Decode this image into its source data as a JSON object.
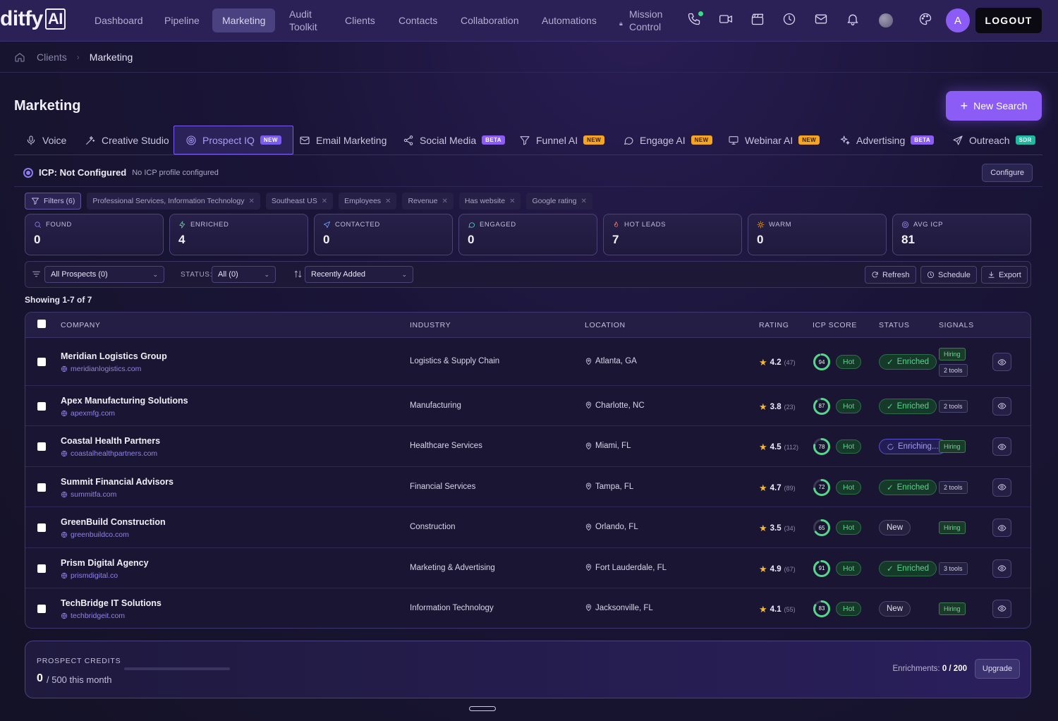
{
  "app": {
    "logo_text": "ditfy",
    "logo_ai": "AI",
    "nav": [
      {
        "label": "Dashboard"
      },
      {
        "label": "Pipeline"
      },
      {
        "label": "Marketing",
        "active": true
      },
      {
        "label_line1": "Audit",
        "label_line2": "Toolkit"
      },
      {
        "label": "Clients"
      },
      {
        "label": "Contacts"
      },
      {
        "label": "Collaboration"
      },
      {
        "label": "Automations"
      },
      {
        "label_line1": "Mission",
        "label_line2": "Control"
      }
    ],
    "icons": [
      "phone-icon",
      "video-icon",
      "clapperboard-icon",
      "clock-icon",
      "mail-icon",
      "bell-icon",
      "status-avatar",
      "palette-icon"
    ],
    "avatar_initial": "A",
    "logout_label": "LOGOUT"
  },
  "breadcrumb": {
    "items": [
      "Clients",
      "Marketing"
    ]
  },
  "page": {
    "title": "Marketing",
    "new_search_label": "New Search"
  },
  "tabs": [
    {
      "label": "Voice",
      "icon": "mic-icon"
    },
    {
      "label": "Creative Studio",
      "icon": "wand-icon"
    },
    {
      "label": "Prospect IQ",
      "icon": "target-icon",
      "badge": "NEW",
      "active": true
    },
    {
      "label": "Email Marketing",
      "icon": "mail-icon"
    },
    {
      "label": "Social Media",
      "icon": "share-icon",
      "badge": "BETA"
    },
    {
      "label": "Funnel AI",
      "icon": "funnel-icon",
      "badge": "NEW"
    },
    {
      "label": "Engage AI",
      "icon": "chat-icon",
      "badge": "NEW"
    },
    {
      "label": "Webinar AI",
      "icon": "monitor-icon",
      "badge": "NEW"
    },
    {
      "label": "Advertising",
      "icon": "sparkle-icon",
      "badge": "BETA"
    },
    {
      "label": "Outreach",
      "icon": "send-icon",
      "badge": "SDR"
    }
  ],
  "icp": {
    "title": "ICP: Not Configured",
    "subtitle": "No ICP profile configured",
    "configure_label": "Configure"
  },
  "filters": {
    "main_label": "Filters (6)",
    "chips": [
      "Professional Services, Information Technology",
      "Southeast US",
      "Employees",
      "Revenue",
      "Has website",
      "Google rating"
    ]
  },
  "stats": [
    {
      "label": "FOUND",
      "value": "0",
      "icon": "search-icon"
    },
    {
      "label": "ENRICHED",
      "value": "4",
      "icon": "bolt-icon"
    },
    {
      "label": "CONTACTED",
      "value": "0",
      "icon": "send-icon"
    },
    {
      "label": "ENGAGED",
      "value": "0",
      "icon": "chat-icon"
    },
    {
      "label": "HOT LEADS",
      "value": "7",
      "icon": "flame-icon"
    },
    {
      "label": "WARM",
      "value": "0",
      "icon": "sun-icon"
    },
    {
      "label": "AVG ICP",
      "value": "81",
      "icon": "target-icon"
    }
  ],
  "toolbar": {
    "prospects_select": "All Prospects (0)",
    "status_label": "STATUS:",
    "status_select": "All (0)",
    "sort_select": "Recently Added",
    "refresh_label": "Refresh",
    "schedule_label": "Schedule",
    "export_label": "Export"
  },
  "showing": "Showing 1-7 of 7",
  "table": {
    "headers": {
      "company": "COMPANY",
      "industry": "INDUSTRY",
      "location": "LOCATION",
      "rating": "RATING",
      "icp": "ICP SCORE",
      "status": "STATUS",
      "signals": "SIGNALS"
    },
    "rows": [
      {
        "name": "Meridian Logistics Group",
        "website": "meridianlogistics.com",
        "industry": "Logistics & Supply Chain",
        "location": "Atlanta, GA",
        "rating": "4.2",
        "reviews": "(47)",
        "icp": "94",
        "tier": "Hot",
        "status": "Enriched",
        "status_type": "enriched",
        "signals": [
          "Hiring",
          "2 tools"
        ]
      },
      {
        "name": "Apex Manufacturing Solutions",
        "website": "apexmfg.com",
        "industry": "Manufacturing",
        "location": "Charlotte, NC",
        "rating": "3.8",
        "reviews": "(23)",
        "icp": "87",
        "tier": "Hot",
        "status": "Enriched",
        "status_type": "enriched",
        "signals": [
          "2 tools"
        ]
      },
      {
        "name": "Coastal Health Partners",
        "website": "coastalhealthpartners.com",
        "industry": "Healthcare Services",
        "location": "Miami, FL",
        "rating": "4.5",
        "reviews": "(112)",
        "icp": "78",
        "tier": "Hot",
        "status": "Enriching...",
        "status_type": "enriching",
        "signals": [
          "Hiring"
        ]
      },
      {
        "name": "Summit Financial Advisors",
        "website": "summitfa.com",
        "industry": "Financial Services",
        "location": "Tampa, FL",
        "rating": "4.7",
        "reviews": "(89)",
        "icp": "72",
        "tier": "Hot",
        "status": "Enriched",
        "status_type": "enriched",
        "signals": [
          "2 tools"
        ]
      },
      {
        "name": "GreenBuild Construction",
        "website": "greenbuildco.com",
        "industry": "Construction",
        "location": "Orlando, FL",
        "rating": "3.5",
        "reviews": "(34)",
        "icp": "65",
        "tier": "Hot",
        "status": "New",
        "status_type": "new",
        "signals": [
          "Hiring"
        ]
      },
      {
        "name": "Prism Digital Agency",
        "website": "prismdigital.co",
        "industry": "Marketing & Advertising",
        "location": "Fort Lauderdale, FL",
        "rating": "4.9",
        "reviews": "(67)",
        "icp": "91",
        "tier": "Hot",
        "status": "Enriched",
        "status_type": "enriched",
        "signals": [
          "3 tools"
        ]
      },
      {
        "name": "TechBridge IT Solutions",
        "website": "techbridgeit.com",
        "industry": "Information Technology",
        "location": "Jacksonville, FL",
        "rating": "4.1",
        "reviews": "(55)",
        "icp": "83",
        "tier": "Hot",
        "status": "New",
        "status_type": "new",
        "signals": [
          "Hiring"
        ]
      }
    ]
  },
  "credits": {
    "label": "PROSPECT CREDITS",
    "used": "0",
    "of_text": "/ 500 this month",
    "usage_fraction": 0,
    "enrichments_label": "Enrichments:",
    "enrichments_value": "0 / 200",
    "upgrade_label": "Upgrade"
  },
  "colors": {
    "accent": "#8b5cf6",
    "hot_green": "#56d68b",
    "star": "#f5b82e"
  }
}
